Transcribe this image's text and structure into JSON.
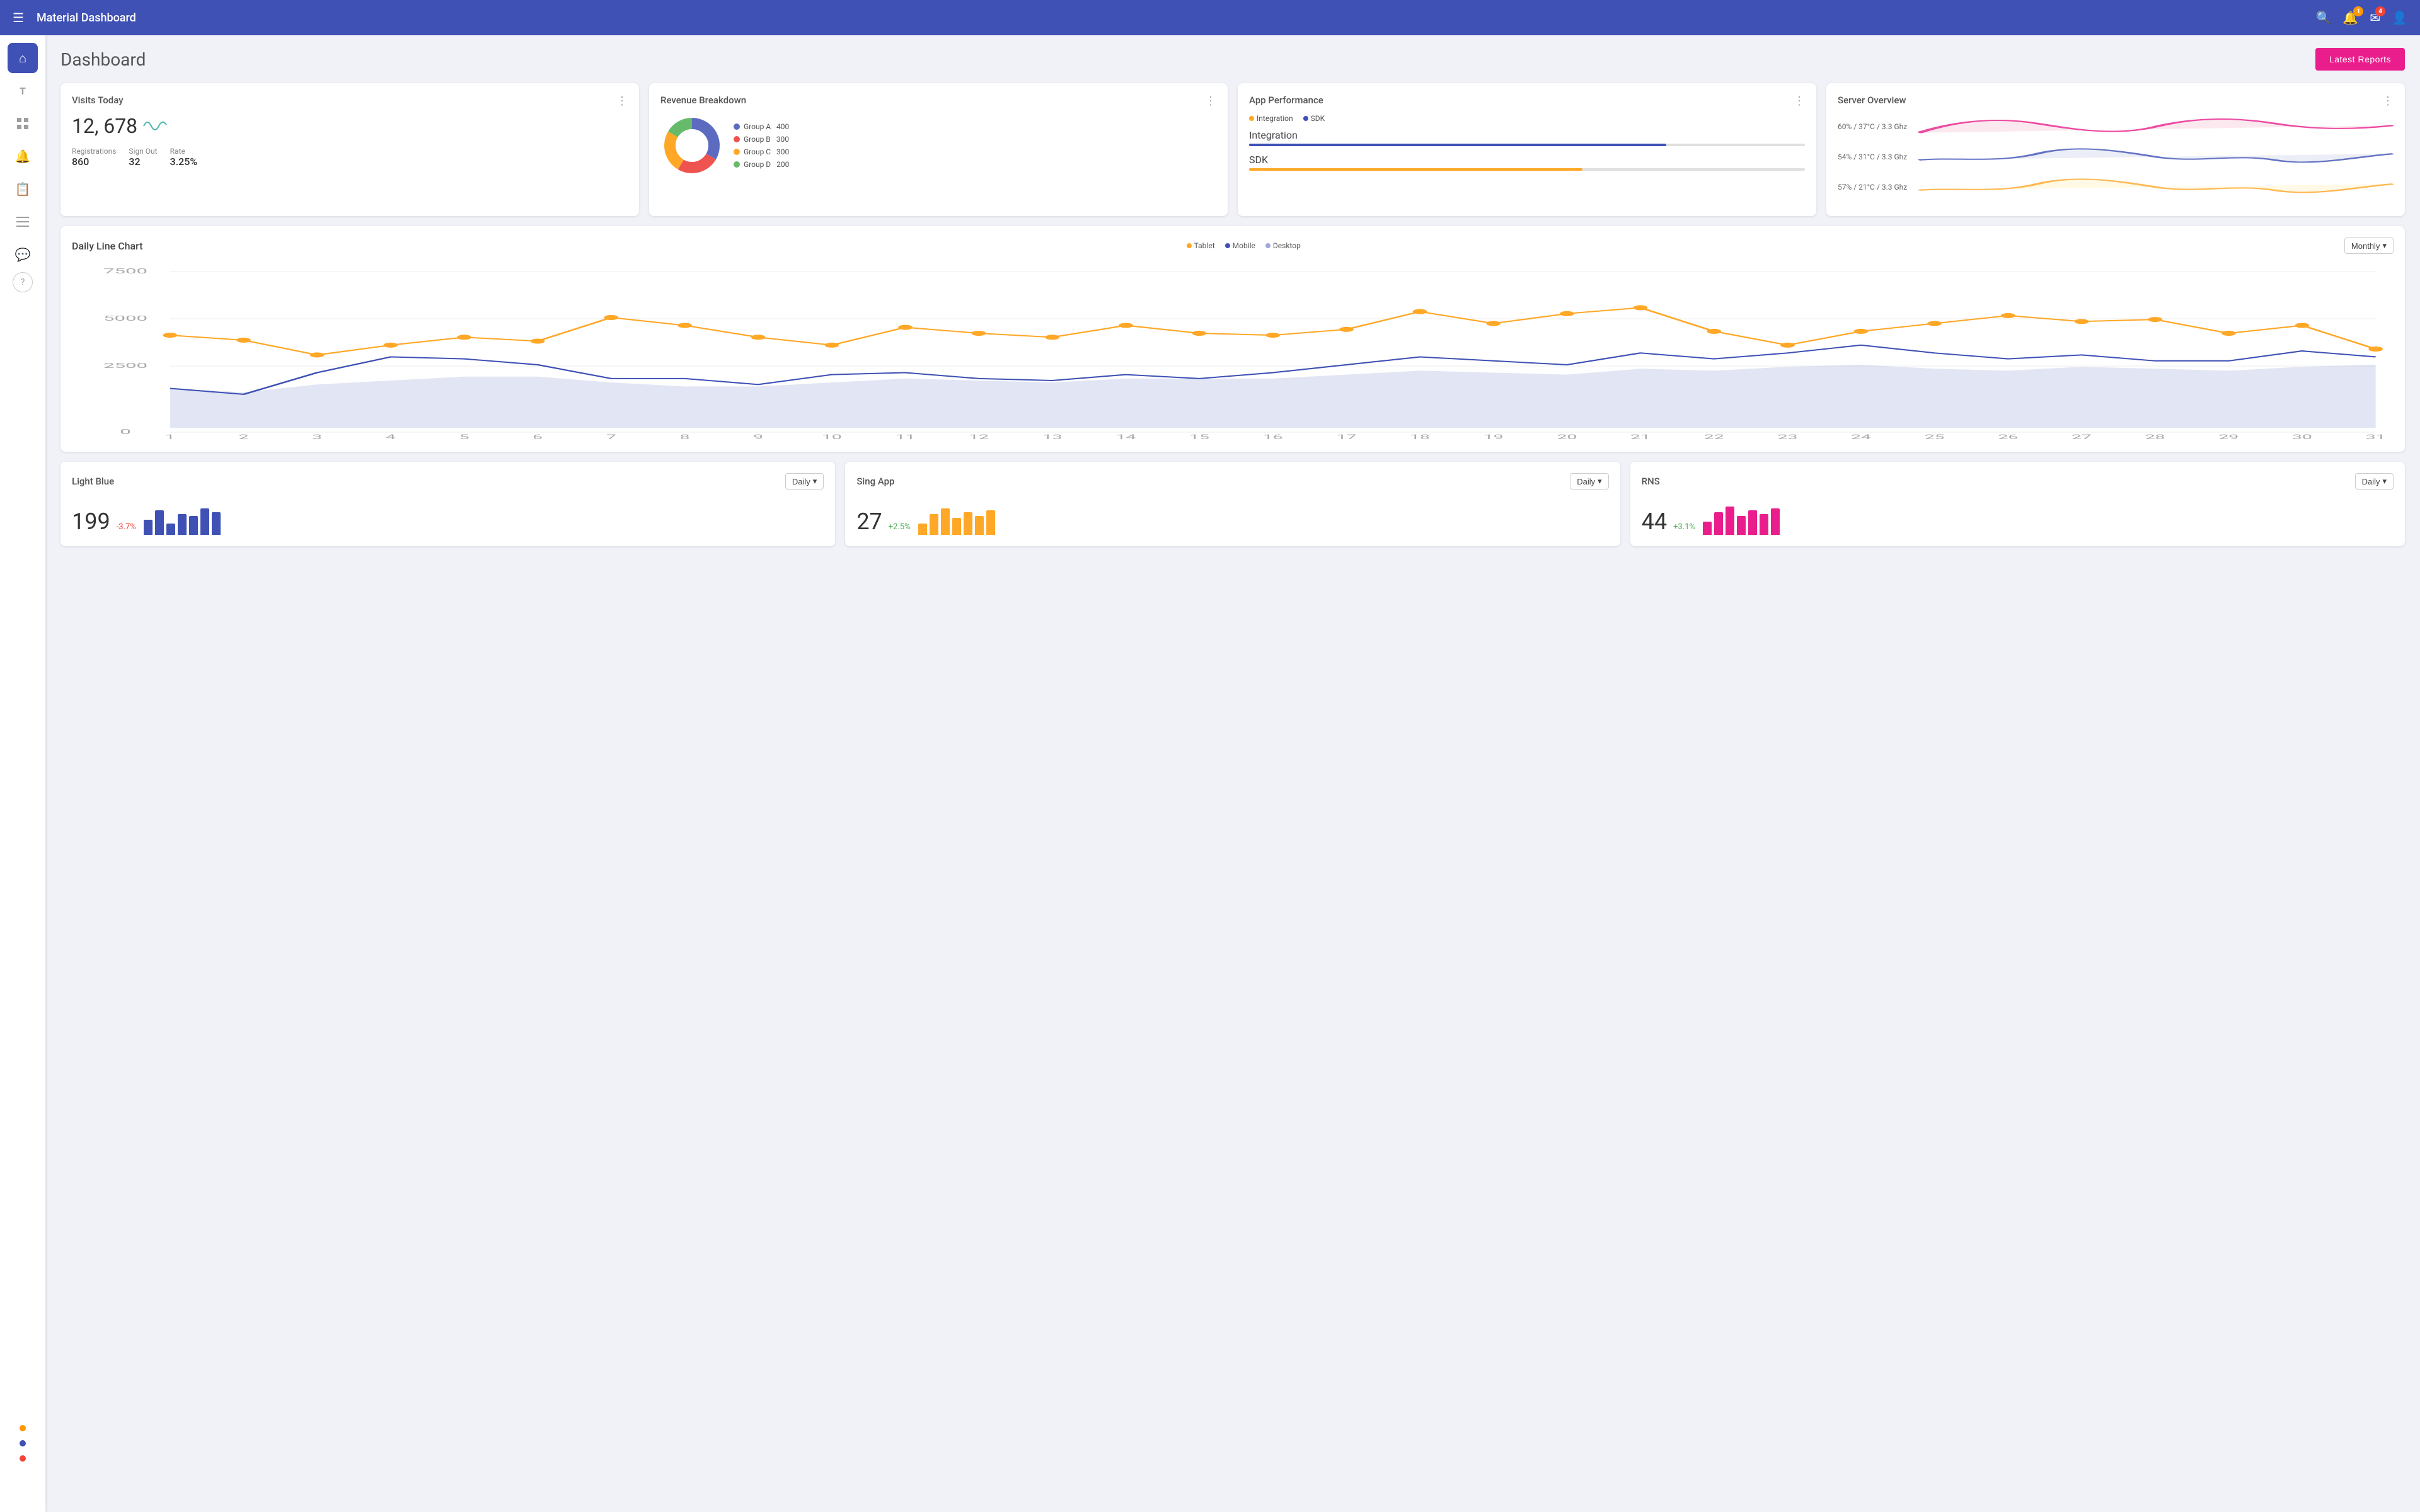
{
  "topnav": {
    "hamburger": "☰",
    "title": "Material Dashboard",
    "search_icon": "🔍",
    "bell_icon": "🔔",
    "bell_badge": "1",
    "bell_badge_color": "yellow",
    "mail_icon": "✉",
    "mail_badge": "4",
    "mail_badge_color": "red",
    "user_icon": "👤"
  },
  "sidebar": {
    "items": [
      {
        "id": "home",
        "icon": "⌂",
        "active": true
      },
      {
        "id": "text",
        "icon": "T",
        "active": false
      },
      {
        "id": "grid",
        "icon": "▦",
        "active": false
      },
      {
        "id": "bell",
        "icon": "🔔",
        "active": false
      },
      {
        "id": "book",
        "icon": "📋",
        "active": false
      },
      {
        "id": "list2",
        "icon": "≡",
        "active": false
      },
      {
        "id": "chat",
        "icon": "💬",
        "active": false
      },
      {
        "id": "help",
        "icon": "?",
        "active": false
      }
    ],
    "dots": [
      {
        "color": "#ff9800"
      },
      {
        "color": "#3f51b5"
      },
      {
        "color": "#f44336"
      }
    ]
  },
  "page": {
    "title": "Dashboard",
    "latest_reports_btn": "Latest Reports"
  },
  "visits_today": {
    "title": "Visits Today",
    "number": "12, 678",
    "wave": "〜",
    "registrations_label": "Registrations",
    "registrations_value": "860",
    "sign_out_label": "Sign Out",
    "sign_out_value": "32",
    "rate_label": "Rate",
    "rate_value": "3.25%",
    "menu_icon": "⋮"
  },
  "revenue_breakdown": {
    "title": "Revenue Breakdown",
    "menu_icon": "⋮",
    "groups": [
      {
        "label": "Group A",
        "value": 400,
        "color": "#5c6bc0"
      },
      {
        "label": "Group B",
        "value": 300,
        "color": "#ef5350"
      },
      {
        "label": "Group C",
        "value": 300,
        "color": "#ffa726"
      },
      {
        "label": "Group D",
        "value": 200,
        "color": "#66bb6a"
      }
    ]
  },
  "app_performance": {
    "title": "App Performance",
    "menu_icon": "⋮",
    "legend": [
      {
        "label": "Integration",
        "color": "#ffa726"
      },
      {
        "label": "SDK",
        "color": "#3f51b5"
      }
    ],
    "bars": [
      {
        "label": "Integration",
        "percent": 75,
        "color": "#3f51b5"
      },
      {
        "label": "SDK",
        "percent": 60,
        "color": "#ffa726"
      }
    ]
  },
  "server_overview": {
    "title": "Server Overview",
    "menu_icon": "⋮",
    "rows": [
      {
        "label": "60% / 37°C / 3.3 Ghz",
        "color": "#e91e8c",
        "fill": "#fce4ec"
      },
      {
        "label": "54% / 31°C / 3.3 Ghz",
        "color": "#3f51b5",
        "fill": "#e8eaf6"
      },
      {
        "label": "57% / 21°C / 3.3 Ghz",
        "color": "#ffa726",
        "fill": "#fff8e1"
      }
    ]
  },
  "daily_chart": {
    "title": "Daily Line Chart",
    "menu_icon": "⋮",
    "period_selector": "Monthly",
    "legend": [
      {
        "label": "Tablet",
        "color": "#ffa726"
      },
      {
        "label": "Mobile",
        "color": "#3f51b5"
      },
      {
        "label": "Desktop",
        "color": "#9fa8da"
      }
    ],
    "y_labels": [
      "0",
      "2500",
      "5000",
      "7500"
    ],
    "x_labels": [
      "1",
      "2",
      "3",
      "4",
      "5",
      "6",
      "7",
      "8",
      "9",
      "10",
      "11",
      "12",
      "13",
      "14",
      "15",
      "16",
      "17",
      "18",
      "19",
      "20",
      "21",
      "22",
      "23",
      "24",
      "25",
      "26",
      "27",
      "28",
      "29",
      "30",
      "31"
    ],
    "tablet_data": [
      4700,
      4450,
      3700,
      4200,
      4600,
      4400,
      5600,
      5200,
      4600,
      4200,
      5100,
      4800,
      4600,
      5200,
      4800,
      4700,
      5000,
      5900,
      5300,
      5800,
      6100,
      4900,
      4200,
      4900,
      5300,
      5700,
      5400,
      5500,
      4800,
      5200,
      4000
    ],
    "mobile_data": [
      2000,
      1700,
      2800,
      3600,
      3500,
      3200,
      2500,
      2500,
      2200,
      2700,
      2800,
      2500,
      2400,
      2700,
      2500,
      2800,
      3200,
      3600,
      3400,
      3200,
      3800,
      3500,
      3800,
      4200,
      3800,
      3500,
      3700,
      3400,
      3400,
      3900,
      3600
    ],
    "desktop_data": [
      2000,
      1800,
      2200,
      2400,
      2600,
      2600,
      2300,
      2100,
      2100,
      2300,
      2500,
      2400,
      2300,
      2500,
      2500,
      2500,
      2700,
      2900,
      2800,
      2700,
      3000,
      2900,
      3100,
      3200,
      3000,
      2900,
      3100,
      3000,
      2900,
      3100,
      3200
    ]
  },
  "bottom_cards": [
    {
      "title": "Light Blue",
      "period": "Daily",
      "number": "199",
      "change": "-3.7%",
      "change_color": "#f44336",
      "bar_color": "#3f51b5",
      "bars": [
        40,
        65,
        30,
        55,
        50,
        70,
        60
      ]
    },
    {
      "title": "Sing App",
      "period": "Daily",
      "number": "27",
      "change": "+2.5%",
      "change_color": "#4caf50",
      "bar_color": "#ffa726",
      "bars": [
        30,
        55,
        70,
        45,
        60,
        50,
        65
      ]
    },
    {
      "title": "RNS",
      "period": "Daily",
      "number": "44",
      "change": "+3.1%",
      "change_color": "#4caf50",
      "bar_color": "#e91e8c",
      "bars": [
        35,
        60,
        75,
        50,
        65,
        55,
        70
      ]
    }
  ]
}
